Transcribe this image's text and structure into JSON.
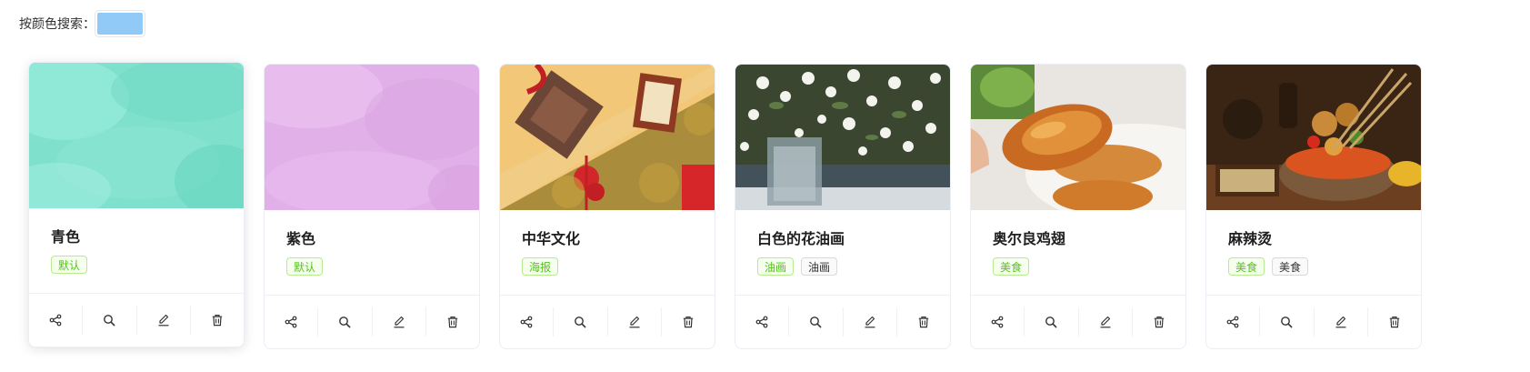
{
  "search": {
    "label": "按颜色搜索：",
    "selected_color": "#91c9f7"
  },
  "cards": [
    {
      "title": "青色",
      "tags": [
        {
          "text": "默认",
          "style": "green"
        }
      ],
      "cover": "teal-watercolor"
    },
    {
      "title": "紫色",
      "tags": [
        {
          "text": "默认",
          "style": "green"
        }
      ],
      "cover": "purple-watercolor"
    },
    {
      "title": "中华文化",
      "tags": [
        {
          "text": "海报",
          "style": "green"
        }
      ],
      "cover": "chinese-culture-photo"
    },
    {
      "title": "白色的花油画",
      "tags": [
        {
          "text": "油画",
          "style": "green"
        },
        {
          "text": "油画",
          "style": "gray"
        }
      ],
      "cover": "white-flower-painting"
    },
    {
      "title": "奥尔良鸡翅",
      "tags": [
        {
          "text": "美食",
          "style": "green"
        }
      ],
      "cover": "chicken-wings-photo"
    },
    {
      "title": "麻辣烫",
      "tags": [
        {
          "text": "美食",
          "style": "green"
        },
        {
          "text": "美食",
          "style": "gray"
        }
      ],
      "cover": "malatang-photo"
    }
  ],
  "actions": [
    "share-icon",
    "search-icon",
    "edit-icon",
    "delete-icon"
  ],
  "colors": {
    "tag_green": "#52c41a",
    "border": "#ebeef5"
  }
}
